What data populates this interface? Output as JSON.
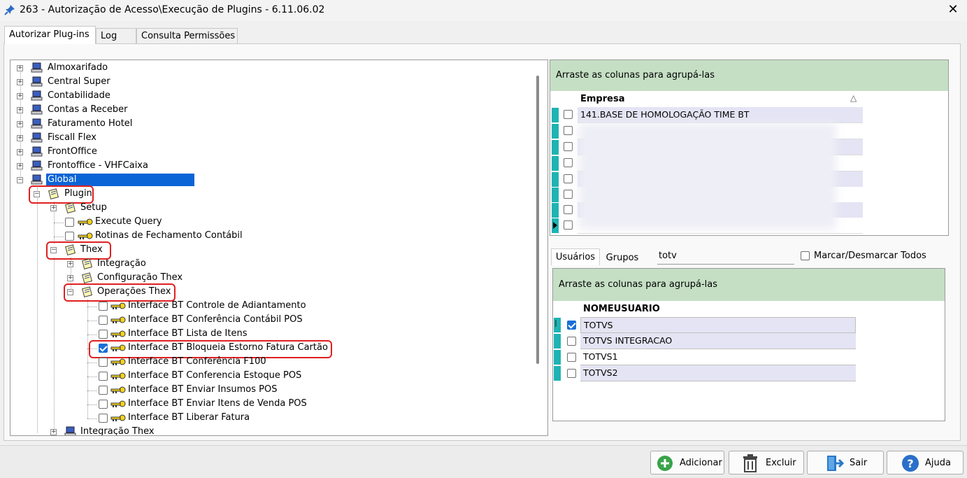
{
  "window": {
    "title": "263 - Autorização de Acesso\\Execução de Plugins - 6.11.06.02",
    "close_glyph": "✕",
    "pin_icon": "pin-icon"
  },
  "tabs": [
    {
      "label": "Autorizar Plug-ins",
      "active": true
    },
    {
      "label": "Log"
    },
    {
      "label": "Consulta Permissões"
    }
  ],
  "tree": {
    "top_items": [
      "Almoxarifado",
      "Central Super",
      "Contabilidade",
      "Contas a Receber",
      "Faturamento Hotel",
      "Fiscall Flex",
      "FrontOffice",
      "Frontoffice - VHFCaixa"
    ],
    "global": "Global",
    "plugin": "Plugin",
    "setup": "Setup",
    "execute_query": "Execute Query",
    "rotinas": "Rotinas de Fechamento Contábil",
    "thex": "Thex",
    "integracao": "Integração",
    "config_thex": "Configuração Thex",
    "operacoes_thex": "Operações Thex",
    "interfaces": [
      {
        "label": "Interface BT Controle de Adiantamento",
        "checked": false
      },
      {
        "label": "Interface BT Conferência Contábil POS",
        "checked": false
      },
      {
        "label": "Interface BT Lista de Itens",
        "checked": false
      },
      {
        "label": "Interface BT Bloqueia Estorno Fatura Cartão",
        "checked": true
      },
      {
        "label": "Interface BT Conferência F100",
        "checked": false
      },
      {
        "label": "Interface BT Conferencia Estoque POS",
        "checked": false
      },
      {
        "label": "Interface BT Enviar Insumos POS",
        "checked": false
      },
      {
        "label": "Interface BT Enviar Itens de Venda POS",
        "checked": false
      },
      {
        "label": "Interface BT Liberar Fatura",
        "checked": false
      }
    ],
    "integracao_thex": "Integração Thex"
  },
  "empresa_grid": {
    "group_hint": "Arraste as colunas para agrupá-las",
    "column": "Empresa",
    "sort_glyph": "△",
    "rows": [
      "141.BASE DE HOMOLOGAÇÃO TIME BT",
      "",
      "",
      "",
      "",
      "",
      "",
      ""
    ]
  },
  "user_tabs": [
    {
      "label": "Usuários",
      "active": true
    },
    {
      "label": "Grupos"
    }
  ],
  "search": {
    "value": "totv"
  },
  "toggle_all": {
    "label": "Marcar/Desmarcar Todos",
    "checked": false
  },
  "user_grid": {
    "group_hint": "Arraste as colunas para agrupá-las",
    "column": "NOMEUSUARIO",
    "rows": [
      {
        "name": "TOTVS",
        "checked": true
      },
      {
        "name": "TOTVS INTEGRACAO",
        "checked": false
      },
      {
        "name": "TOTVS1",
        "checked": false
      },
      {
        "name": "TOTVS2",
        "checked": false
      }
    ]
  },
  "buttons": {
    "add": "Adicionar",
    "delete": "Excluir",
    "exit": "Sair",
    "help": "Ajuda"
  },
  "colors": {
    "selection": "#0a64d6",
    "group_header": "#c5dfc4",
    "row_indicator": "#1fb3b3",
    "highlight_box": "#e02020"
  }
}
